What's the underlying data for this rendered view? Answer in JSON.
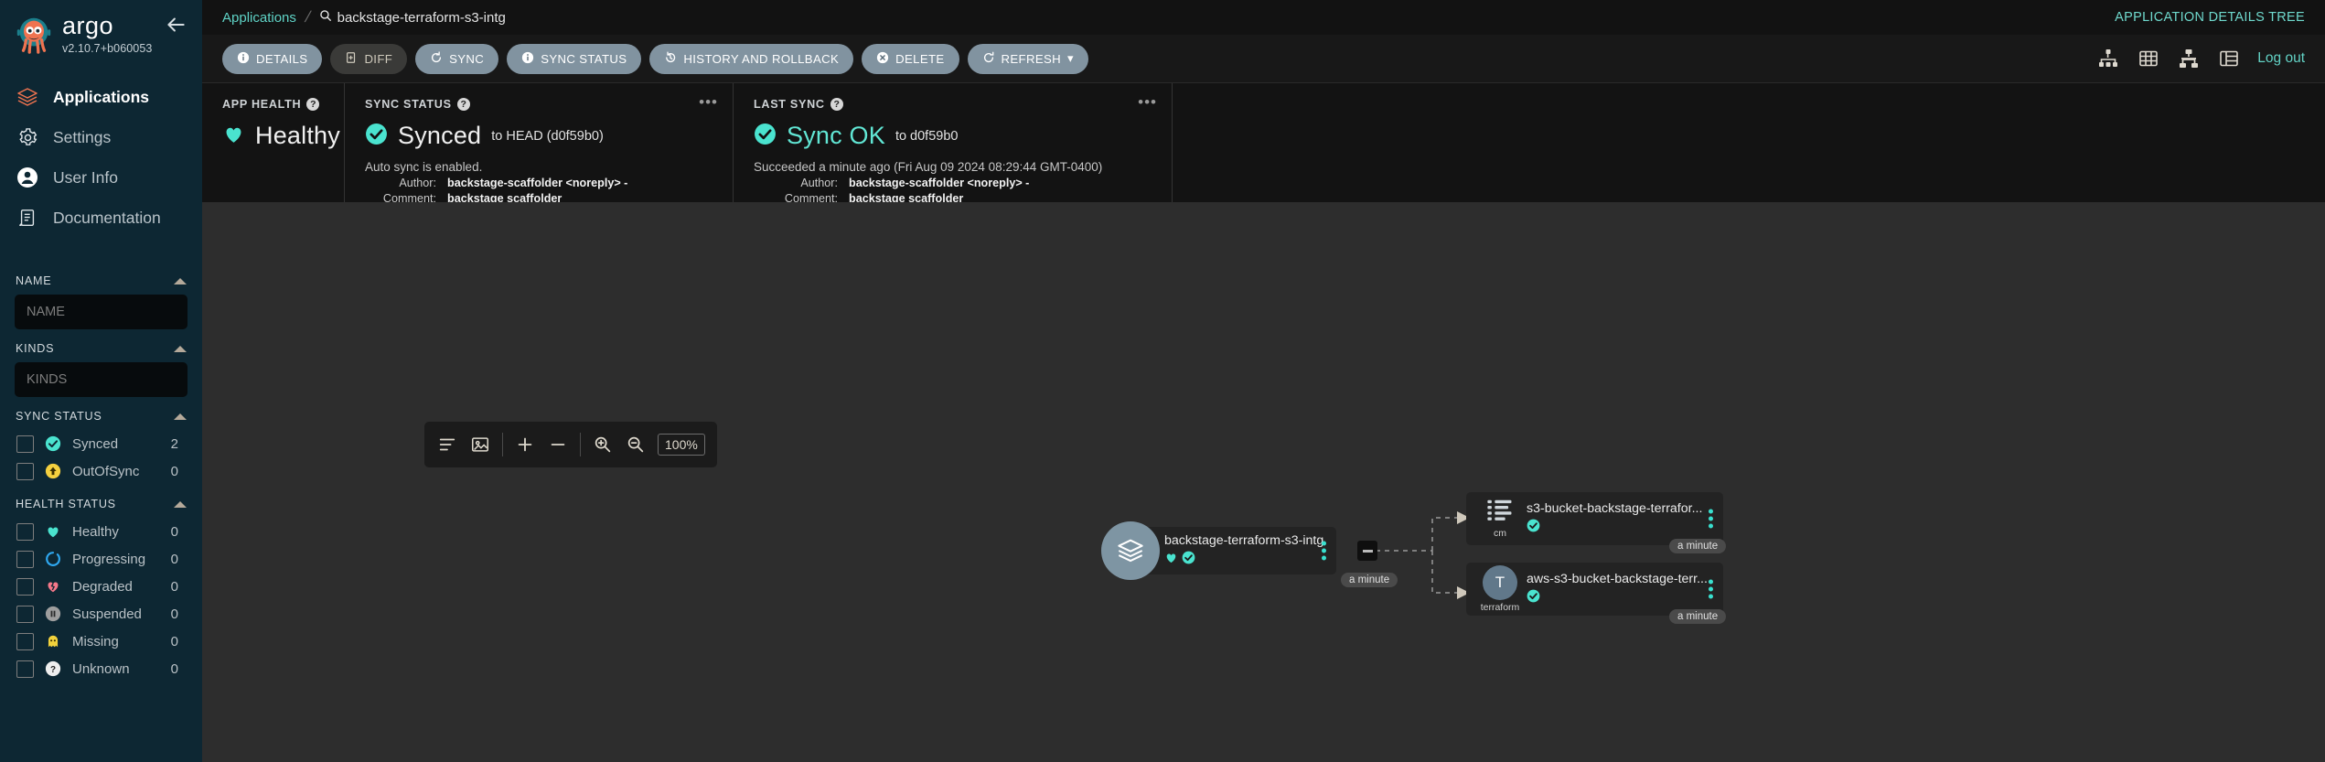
{
  "sidebar": {
    "brand": "argo",
    "version": "v2.10.7+b060053",
    "nav": [
      {
        "label": "Applications",
        "icon": "layers-icon",
        "active": true
      },
      {
        "label": "Settings",
        "icon": "gear-icon",
        "active": false
      },
      {
        "label": "User Info",
        "icon": "user-icon",
        "active": false
      },
      {
        "label": "Documentation",
        "icon": "book-icon",
        "active": false
      }
    ],
    "filters": {
      "name": {
        "title": "NAME",
        "placeholder": "NAME",
        "value": ""
      },
      "kinds": {
        "title": "KINDS",
        "placeholder": "KINDS",
        "value": ""
      },
      "sync_status": {
        "title": "SYNC STATUS",
        "items": [
          {
            "label": "Synced",
            "count": "2",
            "icon": "check-circle-icon",
            "color": "#4ae3cf"
          },
          {
            "label": "OutOfSync",
            "count": "0",
            "icon": "arrow-up-circle-icon",
            "color": "#f4d03f"
          }
        ]
      },
      "health_status": {
        "title": "HEALTH STATUS",
        "items": [
          {
            "label": "Healthy",
            "count": "0",
            "icon": "heart-icon",
            "color": "#4ae3cf"
          },
          {
            "label": "Progressing",
            "count": "0",
            "icon": "spinner-icon",
            "color": "#2fa8f0"
          },
          {
            "label": "Degraded",
            "count": "0",
            "icon": "heart-broken-icon",
            "color": "#f6788a"
          },
          {
            "label": "Suspended",
            "count": "0",
            "icon": "pause-circle-icon",
            "color": "#9e9e9e"
          },
          {
            "label": "Missing",
            "count": "0",
            "icon": "ghost-icon",
            "color": "#f2d23c"
          },
          {
            "label": "Unknown",
            "count": "0",
            "icon": "question-circle-icon",
            "color": "#e8e8e8"
          }
        ]
      }
    }
  },
  "topbar": {
    "breadcrumb_root": "Applications",
    "breadcrumb_current": "backstage-terraform-s3-intg",
    "view_title": "APPLICATION DETAILS TREE"
  },
  "toolbar": {
    "buttons": [
      {
        "label": "DETAILS",
        "icon": "info-icon",
        "style": "primary"
      },
      {
        "label": "DIFF",
        "icon": "diff-icon",
        "style": "muted"
      },
      {
        "label": "SYNC",
        "icon": "sync-icon",
        "style": "primary"
      },
      {
        "label": "SYNC STATUS",
        "icon": "info-icon",
        "style": "primary"
      },
      {
        "label": "HISTORY AND ROLLBACK",
        "icon": "history-icon",
        "style": "primary"
      },
      {
        "label": "DELETE",
        "icon": "delete-icon",
        "style": "primary"
      },
      {
        "label": "REFRESH",
        "icon": "refresh-icon",
        "style": "primary",
        "caret": true
      }
    ],
    "view_icons": [
      "tree-view-icon",
      "pods-grid-icon",
      "network-view-icon",
      "list-view-icon"
    ],
    "logout": "Log out"
  },
  "status": {
    "app_health": {
      "label": "APP HEALTH",
      "value": "Healthy"
    },
    "sync_status": {
      "label": "SYNC STATUS",
      "value": "Synced",
      "revision": "to HEAD (d0f59b0)",
      "note": "Auto sync is enabled.",
      "author_key": "Author:",
      "author_value": "backstage-scaffolder <noreply> -",
      "comment_key": "Comment:",
      "comment_value": "backstage scaffolder"
    },
    "last_sync": {
      "label": "LAST SYNC",
      "value": "Sync OK",
      "revision": "to d0f59b0",
      "note": "Succeeded a minute ago (Fri Aug 09 2024 08:29:44 GMT-0400)",
      "author_key": "Author:",
      "author_value": "backstage-scaffolder <noreply> -",
      "comment_key": "Comment:",
      "comment_value": "backstage scaffolder"
    }
  },
  "tree": {
    "zoom_controls": {
      "level": "100%",
      "icons": [
        "list-layout-icon",
        "fit-to-screen-icon",
        "plus-icon",
        "minus-icon",
        "zoom-in-icon",
        "zoom-out-icon"
      ]
    },
    "app_node": {
      "title": "backstage-terraform-s3-intg",
      "age": "a minute",
      "health_icon": "heart-icon",
      "sync_icon": "check-circle-icon"
    },
    "resources": [
      {
        "title": "s3-bucket-backstage-terrafor...",
        "kind": "cm",
        "kind_icon": "configmap-icon",
        "age": "a minute",
        "sync_icon": "check-circle-icon"
      },
      {
        "title": "aws-s3-bucket-backstage-terr...",
        "kind": "terraform",
        "kind_icon": "terraform-letter-icon",
        "kind_letter": "T",
        "age": "a minute",
        "sync_icon": "check-circle-icon"
      }
    ]
  }
}
